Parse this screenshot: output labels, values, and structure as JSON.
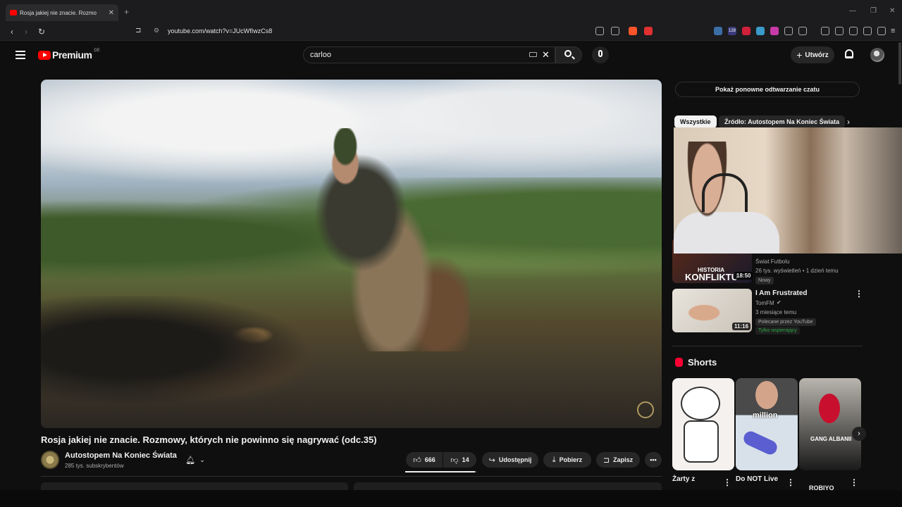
{
  "browser": {
    "tab_title": "Rosja jakiej nie znacie. Rozmo",
    "url": "youtube.com/watch?v=JUcWfIwzCs8",
    "shield_count": "2",
    "ext_badge": "128"
  },
  "header": {
    "logo_text": "Premium",
    "country_code": "DE",
    "search_value": "carloo",
    "create_label": "Utwórz"
  },
  "video": {
    "title": "Rosja jakiej nie znacie. Rozmowy, których nie powinno się nagrywać (odc.35)",
    "channel_name": "Autostopem Na Koniec Świata",
    "channel_subs": "285 tys. subskrybentów",
    "like_count": "666",
    "dislike_count": "14",
    "like_ratio": 0.98,
    "share_label": "Udostępnij",
    "download_label": "Pobierz",
    "save_label": "Zapisz"
  },
  "sidebar": {
    "chat_replay_label": "Pokaż ponowne odtwarzanie czatu",
    "chips": [
      "Wszystkie",
      "Źródło: Autostopem Na Koniec Świata"
    ],
    "recommendations": [
      {
        "thumb_text_1": "HISTORIA",
        "thumb_text_2": "KONFLIKTU",
        "duration": "18:50",
        "channel": "Świat Futbolu",
        "meta": "26 tys. wyświetleń • 1 dzień temu",
        "badge": "Nowy"
      },
      {
        "title": "I Am Frustrated",
        "channel": "TomFM",
        "duration": "11:16",
        "meta": "3 miesiące temu",
        "badge": "Polecane przez YouTube",
        "badge2": "Tylko wspierający"
      }
    ],
    "shorts_heading": "Shorts",
    "shorts": [
      {
        "title": "Żarty z"
      },
      {
        "title": "Do NOT Live",
        "overlay": "million"
      },
      {
        "title": "ROBIYO",
        "overlay": "GANG ALBANII"
      }
    ]
  },
  "colors": {
    "brand_red": "#ff0000",
    "background": "#0f0f0f",
    "chip_active": "#f1f1f1",
    "surface": "#272727"
  }
}
